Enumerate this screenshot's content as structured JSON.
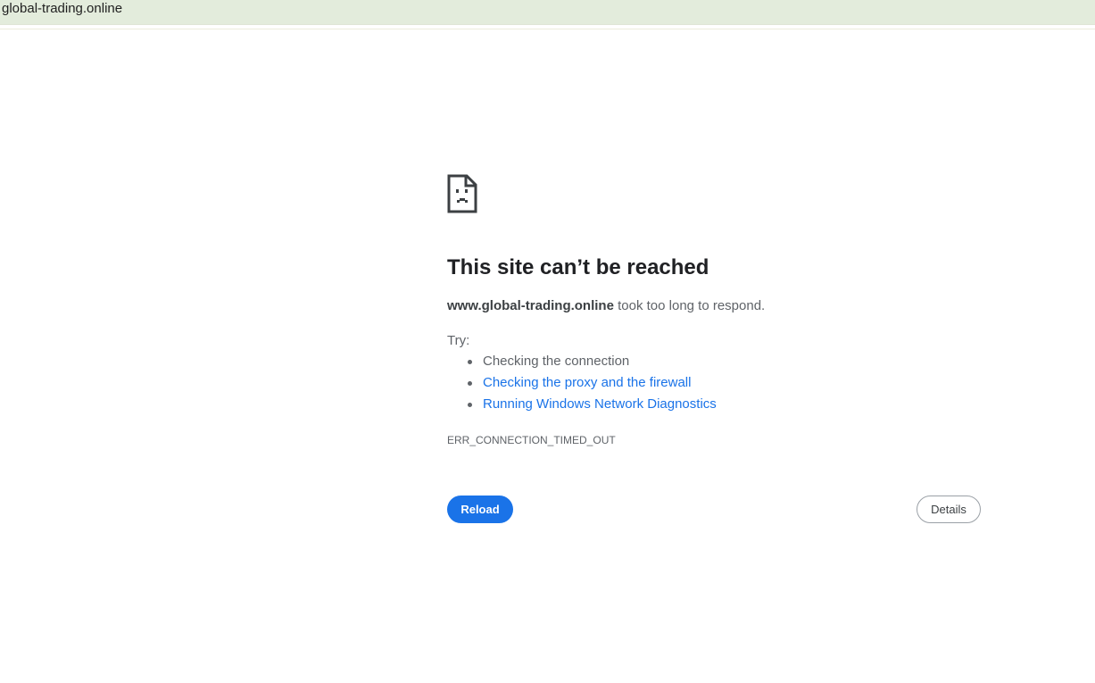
{
  "address_bar": {
    "url": "global-trading.online"
  },
  "error_page": {
    "icon": "sad-page-icon",
    "title": "This site can’t be reached",
    "host": "www.global-trading.online",
    "message": " took too long to respond.",
    "try_label": "Try:",
    "suggestions": [
      {
        "label": "Checking the connection",
        "is_link": false
      },
      {
        "label": "Checking the proxy and the firewall",
        "is_link": true
      },
      {
        "label": "Running Windows Network Diagnostics",
        "is_link": true
      }
    ],
    "error_code": "ERR_CONNECTION_TIMED_OUT",
    "reload_label": "Reload",
    "details_label": "Details"
  },
  "colors": {
    "accent": "#1a73e8",
    "topbar_bg": "#e3ecdc",
    "text_primary": "#202124",
    "text_secondary": "#5f6368"
  }
}
